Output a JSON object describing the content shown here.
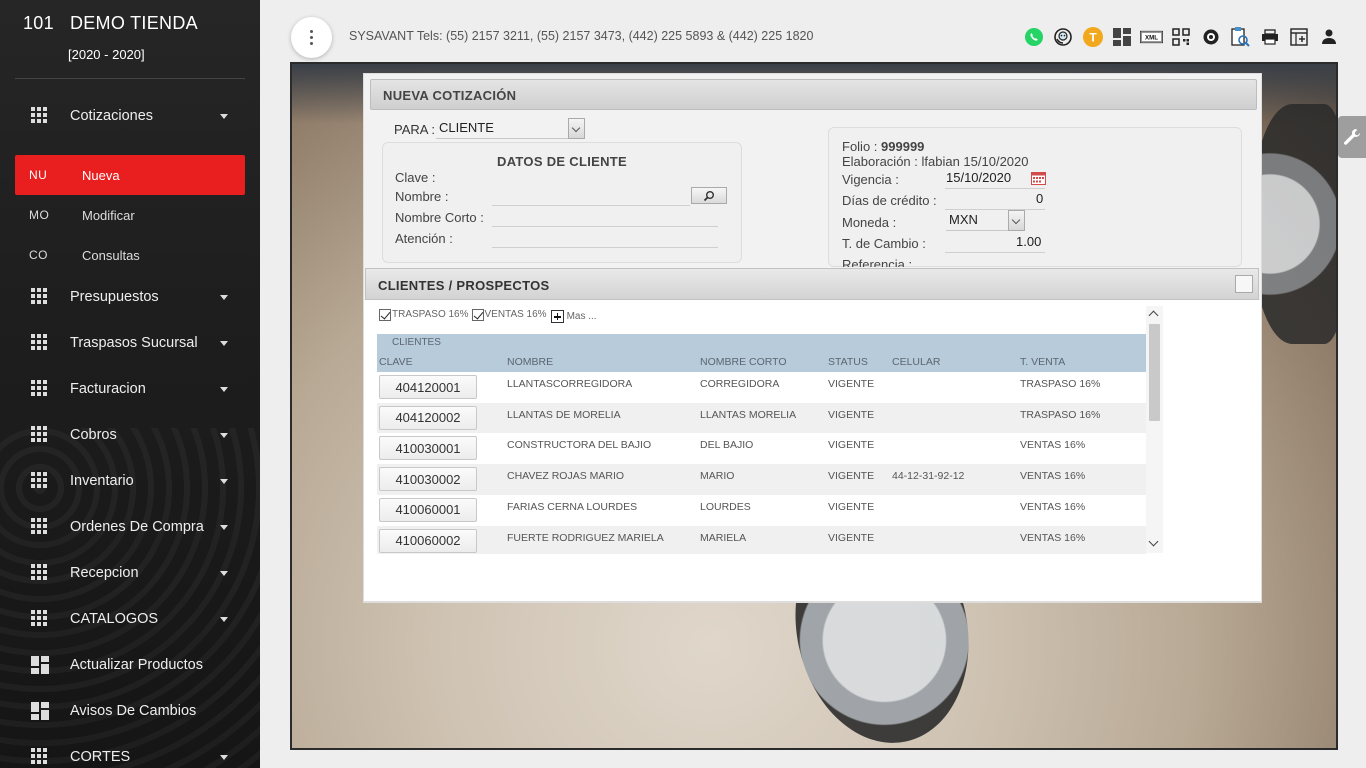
{
  "brand": {
    "number": "101",
    "name": "DEMO TIENDA",
    "period": "[2020 - 2020]"
  },
  "sidebar": {
    "menu": [
      {
        "label": "Cotizaciones",
        "icon": "grid-icon",
        "caret": true
      },
      {
        "label": "Presupuestos",
        "icon": "grid-icon",
        "caret": true
      },
      {
        "label": "Traspasos Sucursal",
        "icon": "grid-icon",
        "caret": true
      },
      {
        "label": "Facturacion",
        "icon": "grid-icon",
        "caret": true
      },
      {
        "label": "Cobros",
        "icon": "grid-icon",
        "caret": true
      },
      {
        "label": "Inventario",
        "icon": "grid-icon",
        "caret": true
      },
      {
        "label": "Ordenes De Compra",
        "icon": "grid-icon",
        "caret": true
      },
      {
        "label": "Recepcion",
        "icon": "grid-icon",
        "caret": true
      },
      {
        "label": "CATALOGOS",
        "icon": "grid-icon",
        "caret": true
      },
      {
        "label": "Actualizar Productos",
        "icon": "dashboard-icon",
        "caret": false
      },
      {
        "label": "Avisos De Cambios",
        "icon": "dashboard-icon",
        "caret": false
      },
      {
        "label": "CORTES",
        "icon": "grid-icon",
        "caret": true
      }
    ],
    "submenu": [
      {
        "abbr": "NU",
        "label": "Nueva",
        "active": true
      },
      {
        "abbr": "MO",
        "label": "Modificar",
        "active": false
      },
      {
        "abbr": "CO",
        "label": "Consultas",
        "active": false
      }
    ],
    "active_color": "#e91e1e"
  },
  "header": {
    "contact": "SYSAVANT Tels: (55) 2157 3211, (55) 2157 3473, (442) 225 5893 & (442) 225 1820",
    "toolbar_icons": [
      "whatsapp-icon",
      "support-icon",
      "t-badge-icon",
      "dashboard-icon",
      "xml-icon",
      "qr-icon",
      "settings-icon",
      "report-icon",
      "print-icon",
      "new-window-icon",
      "user-icon"
    ],
    "t_badge": "T",
    "xml_label": "XML"
  },
  "quote": {
    "title": "NUEVA COTIZACIÓN",
    "para_label": "PARA :",
    "para_value": "CLIENTE",
    "client_section_title": "DATOS DE CLIENTE",
    "fields": {
      "clave": "Clave :",
      "nombre": "Nombre :",
      "nombre_corto": "Nombre Corto :",
      "atencion": "Atención :"
    },
    "folio_label": "Folio :",
    "folio_value": "999999",
    "elaboracion_label": "Elaboración :",
    "elaboracion_value": "lfabian 15/10/2020",
    "vigencia_label": "Vigencia :",
    "vigencia_value": "15/10/2020",
    "dias_credito_label": "Días de crédito :",
    "dias_credito_value": "0",
    "moneda_label": "Moneda :",
    "moneda_value": "MXN",
    "tipo_cambio_label": "T. de Cambio :",
    "tipo_cambio_value": "1.00",
    "referencia_label": "Referencia :"
  },
  "modal": {
    "title": "CLIENTES / PROSPECTOS",
    "filters": [
      {
        "label": "TRASPASO 16%",
        "checked": true
      },
      {
        "label": "VENTAS 16%",
        "checked": true
      }
    ],
    "more_label": "Mas ...",
    "group_label": "CLIENTES",
    "columns": [
      "CLAVE",
      "NOMBRE",
      "NOMBRE CORTO",
      "STATUS",
      "CELULAR",
      "T. VENTA"
    ],
    "rows": [
      {
        "clave": "404120001",
        "nombre": "LLANTASCORREGIDORA",
        "corto": "CORREGIDORA",
        "status": "VIGENTE",
        "celular": "",
        "venta": "TRASPASO 16%"
      },
      {
        "clave": "404120002",
        "nombre": "LLANTAS DE MORELIA",
        "corto": "LLANTAS MORELIA",
        "status": "VIGENTE",
        "celular": "",
        "venta": "TRASPASO 16%"
      },
      {
        "clave": "410030001",
        "nombre": "CONSTRUCTORA DEL BAJIO",
        "corto": "DEL BAJIO",
        "status": "VIGENTE",
        "celular": "",
        "venta": "VENTAS 16%"
      },
      {
        "clave": "410030002",
        "nombre": "CHAVEZ ROJAS MARIO",
        "corto": "MARIO",
        "status": "VIGENTE",
        "celular": "44-12-31-92-12",
        "venta": "VENTAS 16%"
      },
      {
        "clave": "410060001",
        "nombre": "FARIAS CERNA LOURDES",
        "corto": "LOURDES",
        "status": "VIGENTE",
        "celular": "",
        "venta": "VENTAS 16%"
      },
      {
        "clave": "410060002",
        "nombre": "FUERTE RODRIGUEZ MARIELA",
        "corto": "MARIELA",
        "status": "VIGENTE",
        "celular": "",
        "venta": "VENTAS 16%"
      }
    ],
    "header_color": "#b7cbdb"
  }
}
